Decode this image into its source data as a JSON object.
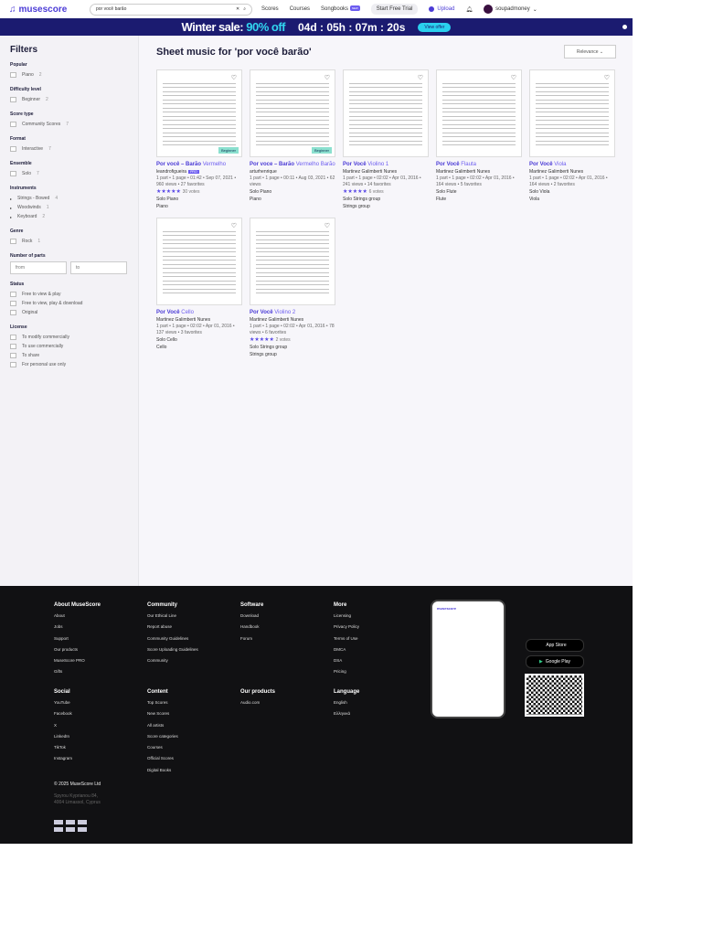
{
  "header": {
    "logo": "musescore",
    "search_value": "por você barão",
    "nav": [
      "Scores",
      "Courses",
      "Songbooks"
    ],
    "new_badge": "NEW",
    "trial": "Start Free Trial",
    "upload": "Upload",
    "username": "soupadmoney"
  },
  "banner": {
    "sale_prefix": "Winter sale:",
    "sale_value": "90% off",
    "timer": "04d : 05h : 07m : 20s",
    "offer": "View offer"
  },
  "filters": {
    "title": "Filters",
    "groups": [
      {
        "title": "Popular",
        "items": [
          {
            "label": "Piano",
            "count": "2"
          }
        ]
      },
      {
        "title": "Difficulty level",
        "items": [
          {
            "label": "Beginner",
            "count": "2"
          }
        ]
      },
      {
        "title": "Score type",
        "items": [
          {
            "label": "Community Scores",
            "count": "7"
          }
        ]
      },
      {
        "title": "Format",
        "items": [
          {
            "label": "Interactive",
            "count": "7"
          }
        ]
      },
      {
        "title": "Ensemble",
        "items": [
          {
            "label": "Solo",
            "count": "7"
          }
        ]
      }
    ],
    "instruments": {
      "title": "Instruments",
      "items": [
        {
          "label": "Strings - Bowed",
          "count": "4"
        },
        {
          "label": "Woodwinds",
          "count": "1"
        },
        {
          "label": "Keyboard",
          "count": "2"
        }
      ]
    },
    "genre": {
      "title": "Genre",
      "items": [
        {
          "label": "Rock",
          "count": "1"
        }
      ]
    },
    "parts": {
      "title": "Number of parts",
      "from": "from",
      "to": "to"
    },
    "status": {
      "title": "Status",
      "items": [
        "Free to view & play",
        "Free to view, play & download",
        "Original"
      ]
    },
    "license": {
      "title": "License",
      "items": [
        "To modify commercially",
        "To use commercially",
        "To share",
        "For personal use only"
      ]
    }
  },
  "results": {
    "title": "Sheet music for 'por você barão'",
    "sort": "Relevance",
    "cards": [
      {
        "title": "Por você – Barão",
        "sub": "Vermelho",
        "author": "leandrofigueira",
        "pro": "PRO",
        "meta": "1 part • 1 page • 01:42 • Sep 07, 2021 • 960 views • 27 favorites",
        "votes": "30 votes",
        "ensemble": "Solo Piano",
        "instrument": "Piano",
        "badge": "Beginner"
      },
      {
        "title": "Por voce – Barão",
        "sub": "Vermelho Barão",
        "author": "arturhenrique",
        "meta": "1 part • 1 page • 00:11 • Aug 03, 2021 • 62 views",
        "ensemble": "Solo Piano",
        "instrument": "Piano",
        "badge": "Beginner"
      },
      {
        "title": "Por Você",
        "sub": "Violino 1",
        "author": "Martinez Galimberti Nunes",
        "meta": "1 part • 1 page • 02:02 • Apr 01, 2016 • 241 views • 14 favorites",
        "votes": "6 votes",
        "ensemble": "Solo Strings group",
        "instrument": "Strings group"
      },
      {
        "title": "Por Você",
        "sub": "Flauta",
        "author": "Martinez Galimberti Nunes",
        "meta": "1 part • 1 page • 02:02 • Apr 01, 2016 • 164 views • 5 favorites",
        "ensemble": "Solo Flute",
        "instrument": "Flute"
      },
      {
        "title": "Por Você",
        "sub": "Viola",
        "author": "Martinez Galimberti Nunes",
        "meta": "1 part • 1 page • 02:02 • Apr 01, 2016 • 164 views • 2 favorites",
        "ensemble": "Solo Viola",
        "instrument": "Viola"
      },
      {
        "title": "Por Você",
        "sub": "Cello",
        "author": "Martinez Galimberti Nunes",
        "meta": "1 part • 1 page • 02:02 • Apr 01, 2016 • 137 views • 3 favorites",
        "ensemble": "Solo Cello",
        "instrument": "Cello"
      },
      {
        "title": "Por Você",
        "sub": "Violino 2",
        "author": "Martinez Galimberti Nunes",
        "meta": "1 part • 1 page • 02:02 • Apr 01, 2016 • 78 views • 6 favorites",
        "votes": "2 votes",
        "ensemble": "Solo Strings group",
        "instrument": "Strings group"
      }
    ]
  },
  "footer": {
    "columns": [
      {
        "title": "About MuseScore",
        "links": [
          "About",
          "Jobs",
          "Support",
          "Our products",
          "MuseScore PRO",
          "Gifts"
        ]
      },
      {
        "title": "Community",
        "links": [
          "Our Ethical Line",
          "Report abuse",
          "Community Guidelines",
          "Score Uploading Guidelines",
          "Community"
        ]
      },
      {
        "title": "Software",
        "links": [
          "Download",
          "Handbook",
          "Forum"
        ]
      },
      {
        "title": "More",
        "links": [
          "Licensing",
          "Privacy Policy",
          "Terms of Use",
          "DMCA",
          "DSA",
          "Pricing"
        ]
      },
      {
        "title": "Social",
        "links": [
          "YouTube",
          "Facebook",
          "X",
          "LinkedIn",
          "TikTok",
          "Instagram"
        ]
      },
      {
        "title": "Content",
        "links": [
          "Top Scores",
          "New Scores",
          "All artists",
          "Score categories",
          "Courses",
          "Official Scores",
          "Digital Books"
        ]
      },
      {
        "title": "Our products",
        "links": [
          "Audio.com"
        ]
      },
      {
        "title": "Language",
        "links": [
          "English",
          "Ελληνικά"
        ]
      }
    ],
    "copyright": "© 2025 MuseScore Ltd",
    "address": "Spyrou Kyprianou 84, 4004 Limassol, Cyprus",
    "app_store": "App Store",
    "google_play": "Google Play"
  },
  "colors": {
    "accent": "#4b3bd6",
    "banner": "#1b1b70",
    "footer": "#111113"
  }
}
